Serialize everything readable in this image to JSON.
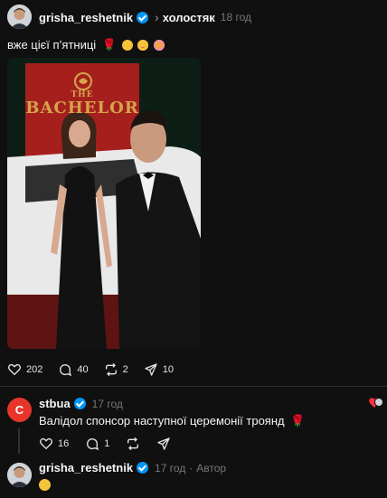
{
  "post": {
    "username": "grisha_reshetnik",
    "separator": "›",
    "topic": "холостяк",
    "time": "18 год",
    "text": "вже цієї п’ятниці",
    "emoji_rose": "🌹",
    "image_sign_word1": "THE",
    "image_sign_word2": "BACHELOR",
    "likes": "202",
    "comments": "40",
    "reposts": "2",
    "shares": "10"
  },
  "reply": {
    "username": "stbua",
    "avatar_letter": "C",
    "time": "17 год",
    "text": "Валідол спонсор наступної церемонії троянд",
    "emoji_rose": "🌹",
    "likes": "16",
    "comments": "1"
  },
  "reply2": {
    "username": "grisha_reshetnik",
    "time": "17 год",
    "dot": "·",
    "author_label": "Автор"
  },
  "colors": {
    "background": "#101010",
    "verified": "#0095f6",
    "stb_red": "#e8352b",
    "muted": "#777777"
  }
}
